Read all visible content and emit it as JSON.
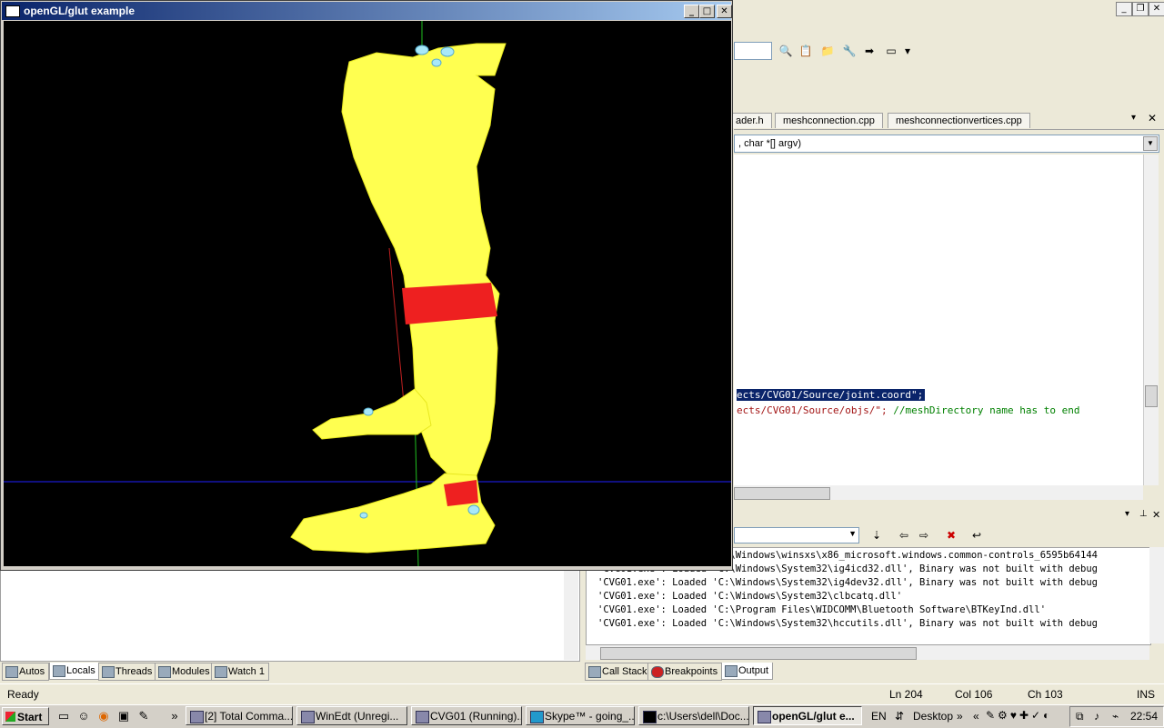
{
  "vs": {
    "file_tabs": [
      "ader.h",
      "meshconnection.cpp",
      "meshconnectionvertices.cpp"
    ],
    "function_dropdown": ", char *[] argv)",
    "code_line1": "ects/CVG01/Source/joint.coord\";",
    "code_line2_string": "ects/CVG01/Source/objs/\";",
    "code_line2_comment": " //meshDirectory name has to end"
  },
  "output": {
    "lines": [
      "'CVG01.exe': Loaded 'C:\\Windows\\winsxs\\x86_microsoft.windows.common-controls_6595b64144",
      "'CVG01.exe': Loaded 'C:\\Windows\\System32\\ig4icd32.dll', Binary was not built with debug",
      "'CVG01.exe': Loaded 'C:\\Windows\\System32\\ig4dev32.dll', Binary was not built with debug",
      "'CVG01.exe': Loaded 'C:\\Windows\\System32\\clbcatq.dll'",
      "'CVG01.exe': Loaded 'C:\\Program Files\\WIDCOMM\\Bluetooth Software\\BTKeyInd.dll'",
      "'CVG01.exe': Loaded 'C:\\Windows\\System32\\hccutils.dll', Binary was not built with debug"
    ]
  },
  "bottom_tabs_left": [
    "Autos",
    "Locals",
    "Threads",
    "Modules",
    "Watch 1"
  ],
  "bottom_tabs_right": [
    "Call Stack",
    "Breakpoints",
    "Output"
  ],
  "status": {
    "ready": "Ready",
    "ln": "Ln 204",
    "col": "Col 106",
    "ch": "Ch 103",
    "ins": "INS"
  },
  "gl_window": {
    "title": "openGL/glut example",
    "min": "_",
    "max": "□",
    "close": "✕"
  },
  "taskbar": {
    "start": "Start",
    "tasks": [
      "[2] Total Comma...",
      "WinEdt  (Unregi...",
      "CVG01 (Running)...",
      "Skype™ - going_...",
      "c:\\Users\\dell\\Doc...",
      "openGL/glut e..."
    ],
    "lang": "EN",
    "desktop": "Desktop",
    "clock": "22:54"
  },
  "colors": {
    "leg": "#ffff44",
    "band": "#ee2222",
    "title_bar": "#0a246a"
  }
}
